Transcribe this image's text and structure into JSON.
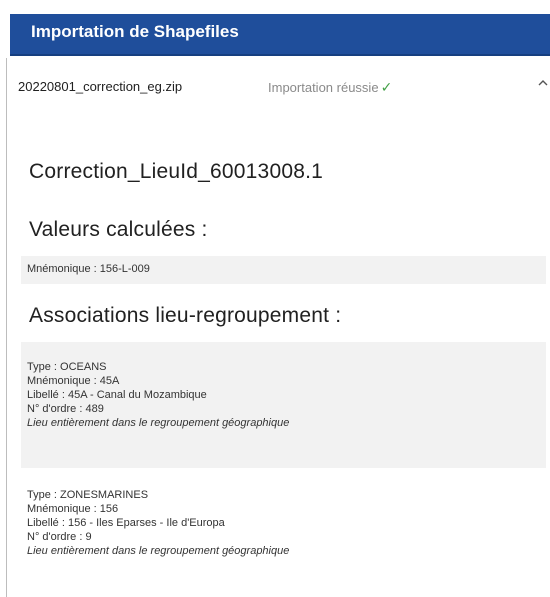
{
  "header": {
    "title": "Importation de Shapefiles"
  },
  "import": {
    "file_name": "20220801_correction_eg.zip",
    "status": "Importation réussie",
    "status_icon": "check-icon",
    "status_color": "#43a047",
    "expand_icon": "chevron-up-icon"
  },
  "detail": {
    "title": "Correction_LieuId_60013008.1",
    "computed": {
      "heading": "Valeurs calculées :",
      "mnemonic": "Mnémonique : 156-L-009"
    },
    "associations": {
      "heading": "Associations lieu-regroupement :",
      "items": [
        {
          "type": "Type : OCEANS",
          "mnemonic": "Mnémonique : 45A",
          "label": "Libellé : 45A - Canal du Mozambique",
          "order": "N° d'ordre : 489",
          "note": "Lieu entièrement dans le regroupement géographique"
        },
        {
          "type": "Type : ZONESMARINES",
          "mnemonic": "Mnémonique : 156",
          "label": "Libellé : 156 - Iles Eparses - Ile d'Europa",
          "order": "N° d'ordre : 9",
          "note": "Lieu entièrement dans le regroupement géographique"
        }
      ]
    }
  },
  "colors": {
    "header_background": "#1f4e9b",
    "panel_background": "#f2f2f2",
    "success": "#43a047"
  }
}
